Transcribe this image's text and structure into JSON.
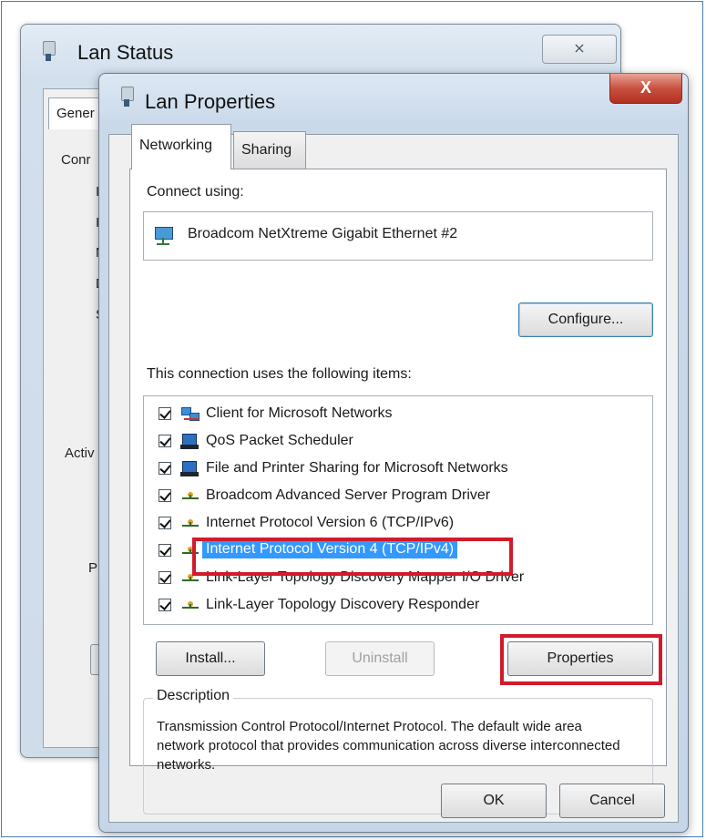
{
  "lan_status": {
    "title": "Lan Status",
    "close_glyph": "⨯",
    "tab_label_fragment": "Gener",
    "fragments": [
      "Conr",
      "IF",
      "IF",
      "M",
      "D",
      "S",
      "Activ",
      "P"
    ]
  },
  "lan_properties": {
    "title": "Lan Properties",
    "close_glyph": "X",
    "tabs": [
      {
        "label": "Networking",
        "active": true
      },
      {
        "label": "Sharing",
        "active": false
      }
    ],
    "connect_using_label": "Connect using:",
    "adapter_name": "Broadcom NetXtreme Gigabit Ethernet #2",
    "configure_button": "Configure...",
    "items_label": "This connection uses the following items:",
    "items": [
      {
        "label": "Client for Microsoft Networks",
        "checked": true,
        "icon": "network-client-icon"
      },
      {
        "label": "QoS Packet Scheduler",
        "checked": true,
        "icon": "computer-icon"
      },
      {
        "label": "File and Printer Sharing for Microsoft Networks",
        "checked": true,
        "icon": "computer-icon"
      },
      {
        "label": "Broadcom Advanced Server Program Driver",
        "checked": true,
        "icon": "protocol-icon"
      },
      {
        "label": "Internet Protocol Version 6 (TCP/IPv6)",
        "checked": true,
        "icon": "protocol-icon"
      },
      {
        "label": "Internet Protocol Version 4 (TCP/IPv4)",
        "checked": true,
        "icon": "protocol-icon",
        "selected": true
      },
      {
        "label": "Link-Layer Topology Discovery Mapper I/O Driver",
        "checked": true,
        "icon": "protocol-icon"
      },
      {
        "label": "Link-Layer Topology Discovery Responder",
        "checked": true,
        "icon": "protocol-icon"
      }
    ],
    "install_button": "Install...",
    "uninstall_button": "Uninstall",
    "properties_button": "Properties",
    "description_legend": "Description",
    "description_text": "Transmission Control Protocol/Internet Protocol. The default wide area network protocol that provides communication across diverse interconnected networks.",
    "ok_button": "OK",
    "cancel_button": "Cancel"
  },
  "colors": {
    "highlight_annotation": "#d11a2a",
    "selection": "#3399ff",
    "close_button_red": "#c8503f"
  }
}
